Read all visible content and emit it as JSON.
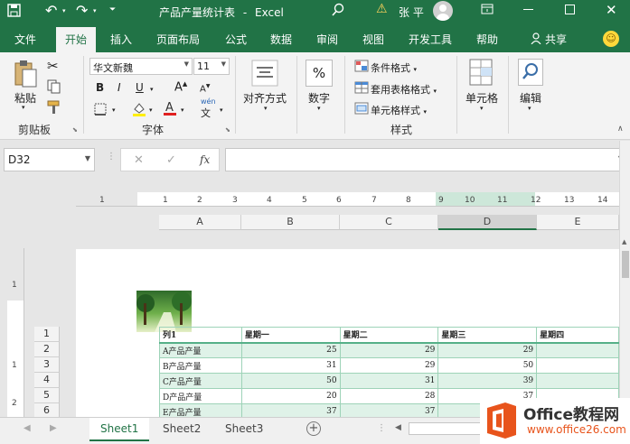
{
  "titlebar": {
    "doc_title": "产品产量统计表",
    "separator": "-",
    "app_name": "Excel",
    "warning_icon_char": "⚠",
    "user_name": "张 平"
  },
  "tabs": [
    "文件",
    "开始",
    "插入",
    "页面布局",
    "公式",
    "数据",
    "审阅",
    "视图",
    "开发工具",
    "帮助"
  ],
  "share_label": "共享",
  "ribbon": {
    "clipboard": {
      "paste_label": "粘贴",
      "group_label": "剪贴板"
    },
    "font": {
      "font_name": "华文新魏",
      "font_size": "11",
      "bold": "B",
      "italic": "I",
      "underline": "U",
      "grow": "A",
      "shrink": "A",
      "wen_label": "wén",
      "wen_char": "文",
      "group_label": "字体"
    },
    "alignment": {
      "label": "对齐方式"
    },
    "number": {
      "label": "数字",
      "icon_char": "%"
    },
    "styles": {
      "conditional": "条件格式",
      "table_format": "套用表格格式",
      "cell_style": "单元格样式",
      "group_label": "样式"
    },
    "cells": {
      "label": "单元格"
    },
    "editing": {
      "label": "编辑"
    }
  },
  "formula_bar": {
    "name_box": "D32",
    "cancel": "✕",
    "enter": "✓",
    "fx": "fx",
    "formula": ""
  },
  "ruler": {
    "ticks": [
      "1",
      "1",
      "2",
      "3",
      "4",
      "5",
      "6",
      "7",
      "8",
      "9",
      "10",
      "11",
      "12",
      "13",
      "14"
    ]
  },
  "columns": [
    "A",
    "B",
    "C",
    "D",
    "E"
  ],
  "row_numbers": [
    "1",
    "2",
    "3",
    "4",
    "5",
    "6"
  ],
  "vruler_labels": [
    "1",
    "1",
    "2"
  ],
  "table": {
    "headers": [
      "列1",
      "星期一",
      "星期二",
      "星期三",
      "星期四"
    ],
    "rows": [
      {
        "name": "A产品产量",
        "values": [
          "25",
          "29",
          "29",
          ""
        ]
      },
      {
        "name": "B产品产量",
        "values": [
          "31",
          "29",
          "50",
          ""
        ]
      },
      {
        "name": "C产品产量",
        "values": [
          "50",
          "31",
          "39",
          ""
        ]
      },
      {
        "name": "D产品产量",
        "values": [
          "20",
          "28",
          "37",
          ""
        ]
      },
      {
        "name": "E产品产量",
        "values": [
          "37",
          "37",
          "",
          ""
        ]
      }
    ]
  },
  "sheets": [
    "Sheet1",
    "Sheet2",
    "Sheet3"
  ],
  "watermark": {
    "brand": "Office教程网",
    "url": "www.office26.com"
  },
  "colors": {
    "accent": "#217346",
    "table_band": "#dff2e8",
    "table_border": "#9ed3b8",
    "logo_orange": "#e8541c"
  }
}
